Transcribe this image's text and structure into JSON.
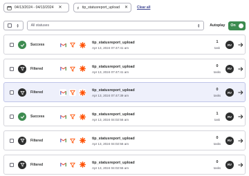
{
  "filters": {
    "date_range": "04/13/2024 - 04/13/2024",
    "zap_name": "tip_statusreport_upload",
    "clear_all": "Clear all"
  },
  "controls": {
    "status_placeholder": "All statuses",
    "autoplay_label": "Autoplay",
    "toggle_label": "On"
  },
  "colors": {
    "accent_green": "#3d8b50",
    "selected_row": "#eef0fb",
    "link": "#3d4592"
  },
  "rows": [
    {
      "status": "Success",
      "status_icon": "check-icon",
      "title": "tip_statusreport_upload",
      "date": "Apr 13, 2024 07:47:41 am",
      "count": "1",
      "count_label": "task",
      "avatar": "RV",
      "selected": false
    },
    {
      "status": "Filtered",
      "status_icon": "filter-icon",
      "title": "tip_statusreport_upload",
      "date": "Apr 13, 2024 07:47:41 am",
      "count": "0",
      "count_label": "tasks",
      "avatar": "RV",
      "selected": false
    },
    {
      "status": "Filtered",
      "status_icon": "filter-icon",
      "title": "tip_statusreport_upload",
      "date": "Apr 13, 2024 07:47:39 am",
      "count": "0",
      "count_label": "tasks",
      "avatar": "RV",
      "selected": true
    },
    {
      "status": "Success",
      "status_icon": "check-icon",
      "title": "tip_statusreport_upload",
      "date": "Apr 13, 2024 04:02:56 am",
      "count": "1",
      "count_label": "task",
      "avatar": "RV",
      "selected": false
    },
    {
      "status": "Filtered",
      "status_icon": "filter-icon",
      "title": "tip_statusreport_upload",
      "date": "Apr 13, 2024 04:02:56 am",
      "count": "0",
      "count_label": "tasks",
      "avatar": "RV",
      "selected": false
    },
    {
      "status": "Filtered",
      "status_icon": "filter-icon",
      "title": "tip_statusreport_upload",
      "date": "Apr 13, 2024 04:02:55 am",
      "count": "0",
      "count_label": "tasks",
      "avatar": "RV",
      "selected": false
    }
  ],
  "row_apps": [
    "gmail-icon",
    "filter-app-icon",
    "zapier-app-icon"
  ]
}
